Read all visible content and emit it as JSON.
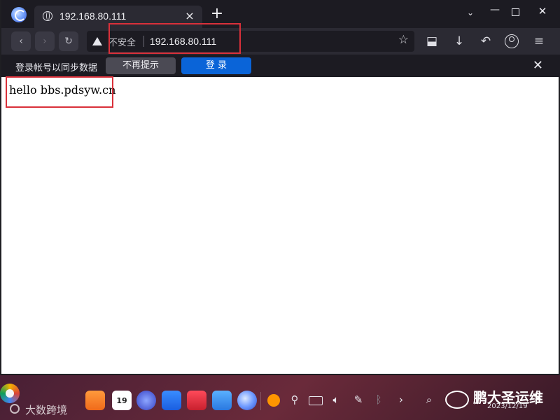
{
  "titlebar": {
    "tab_title": "192.168.80.111",
    "tab_close": "×",
    "new_tab": "+",
    "ctrl_down": "⌄",
    "ctrl_min": "—",
    "ctrl_close": "✕"
  },
  "navbar": {
    "back": "‹",
    "forward": "›",
    "reload": "↻",
    "insecure_label": "不安全",
    "url": "192.168.80.111",
    "star": "☆",
    "save": "⬓",
    "download": "↓",
    "undo": "↶",
    "menu": "≡"
  },
  "syncbar": {
    "message": "登录帐号以同步数据",
    "dismiss_label": "不再提示",
    "login_label": "登 录",
    "close": "✕"
  },
  "content": {
    "text": "hello bbs.pdsyw.cn"
  },
  "taskbar": {
    "calendar_day": "19",
    "usb": "⚲",
    "volume": "🔈︎",
    "pen": "✎",
    "bluetooth": "ᛒ",
    "more": "›",
    "search": "⌕",
    "up": "⏶"
  },
  "overlay": {
    "brand_name": "鹏大圣运维",
    "date": "2023/12/19",
    "watermark": "大数跨境"
  },
  "colors": {
    "highlight": "#d9303a",
    "login_button": "#0a64d8",
    "chrome_dark": "#1c1b22",
    "toolbar": "#2b2a33"
  }
}
